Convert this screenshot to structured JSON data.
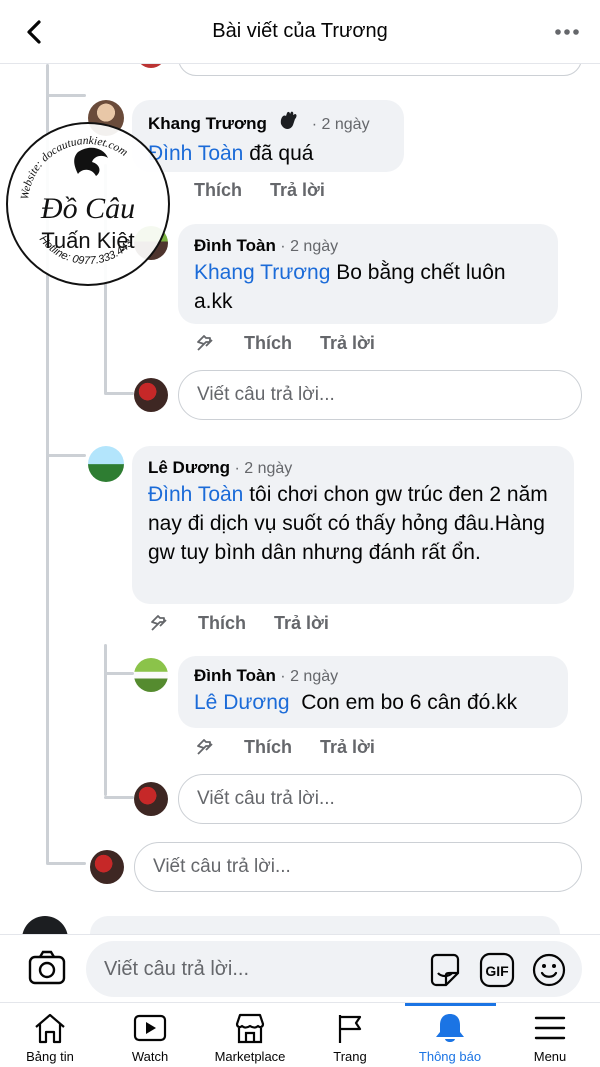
{
  "header": {
    "title": "Bài viết của Trương"
  },
  "watermark": {
    "website": "Website: docautuankiet.com",
    "line1": "Đồ Câu",
    "line2": "Tuấn Kiệt",
    "hotline": "Hotline: 0977.333.443"
  },
  "comments": [
    {
      "author": "Khang Trương",
      "time": "· 2 ngày",
      "mention": "Đình Toàn",
      "text": " đã quá",
      "like": "Thích",
      "reply": "Trả lời"
    },
    {
      "author": "Đình Toàn",
      "time": "· 2 ngày",
      "mention": "Khang Trương",
      "text": " Bo bằng chết luôn a.kk",
      "like": "Thích",
      "reply": "Trả lời"
    },
    {
      "author": "Lê Dương",
      "time": "· 2 ngày",
      "mention": "Đình Toàn",
      "text": " tôi chơi chon gw trúc đen 2 năm nay đi dịch vụ suốt có thấy hỏng đâu.Hàng gw tuy bình dân nhưng đánh rất ổn.",
      "like": "Thích",
      "reply": "Trả lời"
    },
    {
      "author": "Đình Toàn",
      "time": "· 2 ngày",
      "mention": "Lê Dương",
      "text": "  Con em bo 6 cân đó.kk",
      "like": "Thích",
      "reply": "Trả lời"
    }
  ],
  "reply_placeholder": "Viết câu trả lời...",
  "compose": {
    "placeholder": "Viết câu trả lời...",
    "gif_label": "GIF"
  },
  "tabs": [
    {
      "label": "Bảng tin",
      "icon": "home-icon"
    },
    {
      "label": "Watch",
      "icon": "watch-icon"
    },
    {
      "label": "Marketplace",
      "icon": "marketplace-icon"
    },
    {
      "label": "Trang",
      "icon": "flag-icon"
    },
    {
      "label": "Thông báo",
      "icon": "bell-icon",
      "active": true
    },
    {
      "label": "Menu",
      "icon": "menu-icon"
    }
  ],
  "colors": {
    "accent": "#1b74e4",
    "mention": "#1b6bd8",
    "bubble": "#f0f2f5",
    "secondary_text": "#65676b"
  }
}
